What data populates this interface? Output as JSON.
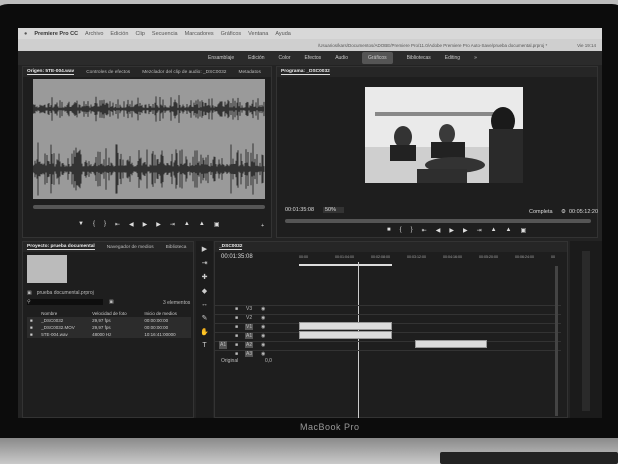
{
  "menubar": {
    "app": "Premiere Pro CC",
    "items": [
      "Archivo",
      "Edición",
      "Clip",
      "Secuencia",
      "Marcadores",
      "Gráficos",
      "Ventana",
      "Ayuda"
    ]
  },
  "pathbar": {
    "path": "/Usuarios/kars/Documentos/ADOBE/Premiere Pro/11.0/Adobe Premiere Pro Auto-Save/prueba documental.prproj *",
    "status": "Vie 19:14"
  },
  "workspaces": {
    "items": [
      "Ensamblaje",
      "Edición",
      "Color",
      "Efectos",
      "Audio",
      "Gráficos",
      "Bibliotecas",
      "Editing"
    ],
    "active": "Gráficos"
  },
  "source": {
    "tabs": [
      "Origen: 5TE-004.wav",
      "Controles de efectos",
      "Mezclador del clip de audio: _DSC0032",
      "Metadatos"
    ]
  },
  "program": {
    "tab": "Programa: _DSC0032",
    "timecode": "00:01:35:08",
    "zoom": "50%",
    "quality": "Completa",
    "duration": "00:05:12:20"
  },
  "project": {
    "tabs": [
      "Proyecto: prueba documental",
      "Navegador de medios",
      "Biblioteca"
    ],
    "file": "prueba documental.prproj",
    "count": "3 elementos",
    "columns": [
      "Nombre",
      "Velocidad de foto",
      "Inicio de medios"
    ],
    "rows": [
      [
        "_DSC0032",
        "29,97 fps",
        "00:00:00:00"
      ],
      [
        "_DSC0032.MOV",
        "29,97 fps",
        "00:00:00:00"
      ],
      [
        "5TE-004.wav",
        "48000 Hz",
        "10:16:41:00000"
      ]
    ]
  },
  "timeline": {
    "tab": "_DSC0032",
    "timecode": "00:01:35:08",
    "ruler": [
      "00:00",
      "00:01:04:00",
      "00:02:08:00",
      "00:03:12:00",
      "00:04:16:00",
      "00:05:20:00",
      "00:06:24:00",
      "00"
    ],
    "tracks": [
      "V3",
      "V2",
      "V1",
      "A1",
      "A2",
      "A3"
    ],
    "master": "Original",
    "master_value": "0,0",
    "source_patch": "A1"
  },
  "device": {
    "brand": "MacBook Pro"
  }
}
